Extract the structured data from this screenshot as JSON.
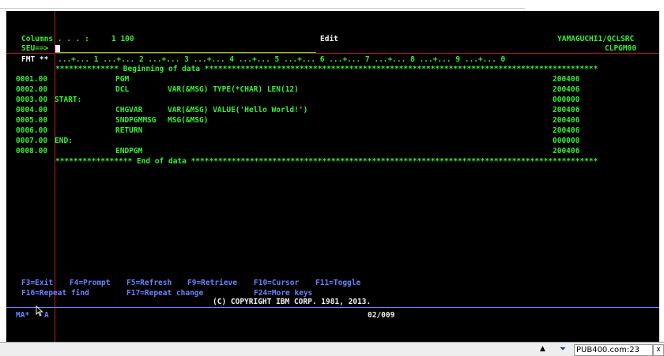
{
  "header": {
    "columns_label": "Columns . . . :",
    "columns_value": "1 100",
    "mode": "Edit",
    "library_file": "YAMAGUCHI1/QCLSRC",
    "member": "CLPGM00",
    "seu_prompt": "SEU==>",
    "fmt_label": "FMT **",
    "ruler": "...+... 1 ...+... 2 ...+... 3 ...+... 4 ...+... 5 ...+... 6 ...+... 7 ...+... 8 ...+... 9 ...+... 0"
  },
  "source": {
    "begin_marker": "************** Beginning of data ***************************************************************************************",
    "end_marker": "***************** End of data ******************************************************************************************",
    "lines": [
      {
        "seq": "0001.00",
        "label": "",
        "cmd": "PGM",
        "params": "",
        "date": "200406"
      },
      {
        "seq": "0002.00",
        "label": "",
        "cmd": "DCL",
        "params": "VAR(&MSG) TYPE(*CHAR) LEN(12)",
        "date": "200406"
      },
      {
        "seq": "0003.00",
        "label": "START:",
        "cmd": "",
        "params": "",
        "date": "000000"
      },
      {
        "seq": "0004.00",
        "label": "",
        "cmd": "CHGVAR",
        "params": "VAR(&MSG) VALUE('Hello World!')",
        "date": "200406"
      },
      {
        "seq": "0005.00",
        "label": "",
        "cmd": "SNDPGMMSG",
        "params": "MSG(&MSG)",
        "date": "200406"
      },
      {
        "seq": "0006.00",
        "label": "",
        "cmd": "RETURN",
        "params": "",
        "date": "200406"
      },
      {
        "seq": "0007.00",
        "label": "END:",
        "cmd": "",
        "params": "",
        "date": "000000"
      },
      {
        "seq": "0008.00",
        "label": "",
        "cmd": "ENDPGM",
        "params": "",
        "date": "200406"
      }
    ]
  },
  "function_keys": {
    "f3": "F3=Exit",
    "f4": "F4=Prompt",
    "f5": "F5=Refresh",
    "f9": "F9=Retrieve",
    "f10": "F10=Cursor",
    "f11": "F11=Toggle",
    "f16": "F16=Repeat find",
    "f17": "F17=Repeat change",
    "f24": "F24=More keys"
  },
  "copyright": "(C) COPYRIGHT IBM CORP. 1981, 2013.",
  "status": {
    "indicator": "MA*",
    "insert": "A",
    "cursor_pos": "02/009"
  },
  "taskbar": {
    "host": "PUB400.com:23",
    "close": "x"
  },
  "colors": {
    "screen_bg": "#000000",
    "text_green": "#34f034",
    "text_white": "#f2f2f2",
    "text_blue": "#6c82ff",
    "rule_red": "#c01818"
  }
}
